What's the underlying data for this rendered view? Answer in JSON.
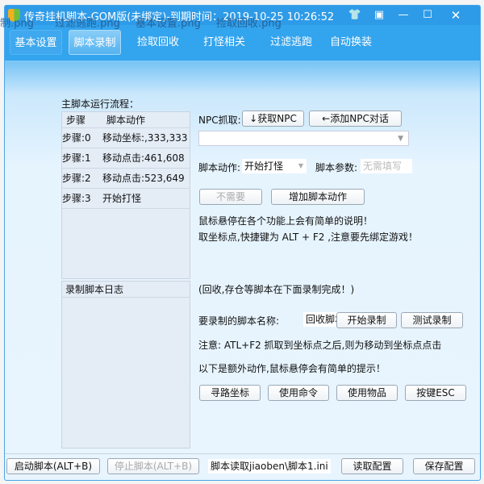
{
  "desktop_files": [
    "制.png",
    "过滤逃跑.png",
    "基本设置.png",
    "捡取回收.png"
  ],
  "window": {
    "title": "传奇挂机脚本-GOM版(未绑定)-到期时间：2019-10-25 10:26:52",
    "controls": [
      "shirt-icon",
      "skin-icon",
      "minimize-icon",
      "maximize-icon",
      "close-icon"
    ]
  },
  "tabs": [
    {
      "label": "基本设置"
    },
    {
      "label": "脚本录制",
      "active": true
    },
    {
      "label": "捡取回收"
    },
    {
      "label": "打怪相关"
    },
    {
      "label": "过滤逃跑"
    },
    {
      "label": "自动换装"
    }
  ],
  "flow": {
    "label": "主脚本运行流程：",
    "headers": [
      "步骤",
      "脚本动作"
    ],
    "rows": [
      {
        "step": "步骤:0",
        "action": "移动坐标:,333,333"
      },
      {
        "step": "步骤:1",
        "action": "移动点击:461,608"
      },
      {
        "step": "步骤:2",
        "action": "移动点击:523,649"
      },
      {
        "step": "步骤:3",
        "action": "开始打怪"
      }
    ]
  },
  "npc": {
    "label": "NPC抓取:",
    "get_button": "↓获取NPC",
    "add_button": "←添加NPC对话",
    "dropdown_value": ""
  },
  "action": {
    "label": "脚本动作:",
    "value": "开始打怪",
    "param_label": "脚本参数:",
    "param_placeholder": "无需填写",
    "not_needed_button": "不需要",
    "add_button": "增加脚本动作"
  },
  "hints": [
    "鼠标悬停在各个功能上会有简单的说明！",
    "取坐标点,快捷键为  ALT + F2 ,注意要先绑定游戏！"
  ],
  "log": {
    "header": "录制脚本日志"
  },
  "record": {
    "note": "(回收,存仓等脚本在下面录制完成！)",
    "name_label": "要录制的脚本名称:",
    "name_value": "回收脚本",
    "start_button": "开始录制",
    "test_button": "测试录制",
    "notice": "注意: ATL+F2 抓取到坐标点之后,则为移动到坐标点点击",
    "extra_hint": "以下是额外动作,鼠标悬停会有简单的提示！",
    "extra_buttons": [
      "寻路坐标",
      "使用命令",
      "使用物品",
      "按键ESC"
    ]
  },
  "footer": {
    "start_button": "启动脚本(ALT+B)",
    "stop_button": "停止脚本(ALT+B)",
    "path": "脚本读取jiaoben\\脚本1.ini",
    "load_button": "读取配置",
    "save_button": "保存配置"
  }
}
